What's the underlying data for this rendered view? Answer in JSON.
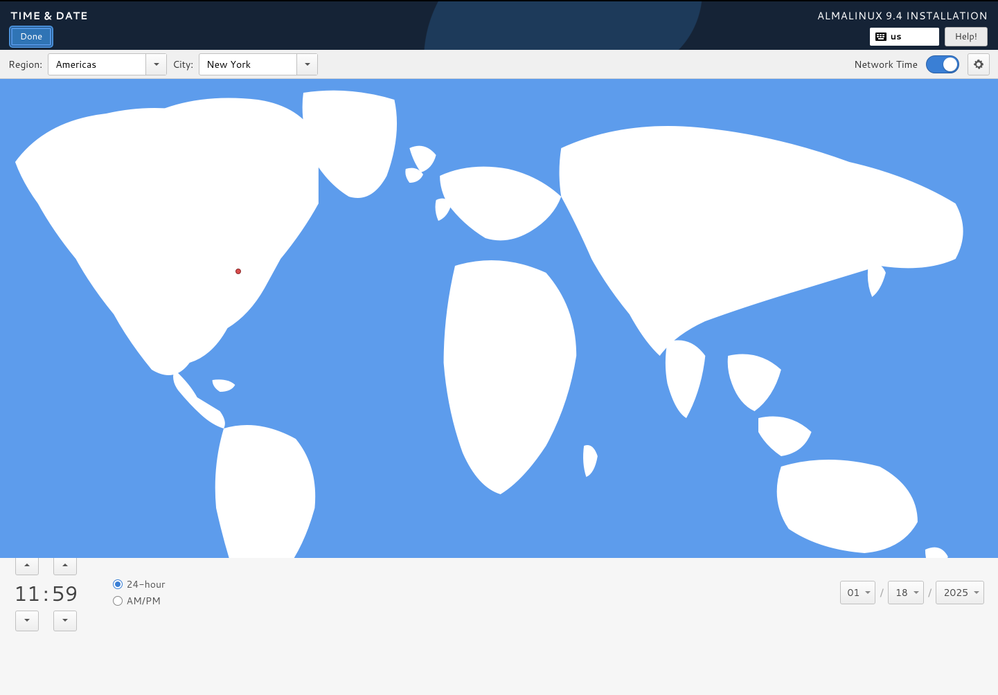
{
  "header": {
    "title": "TIME & DATE",
    "done_label": "Done",
    "install_title": "ALMALINUX 9.4 INSTALLATION",
    "keyboard_layout": "us",
    "help_label": "Help!"
  },
  "toolbar": {
    "region_label": "Region:",
    "region_value": "Americas",
    "city_label": "City:",
    "city_value": "New York",
    "network_time_label": "Network Time",
    "network_time_on": true
  },
  "map": {
    "marker_city": "New York"
  },
  "time": {
    "hours": "11",
    "minutes": "59"
  },
  "format": {
    "opt_24": "24-hour",
    "opt_ampm": "AM/PM",
    "selected": "24-hour"
  },
  "date": {
    "month": "01",
    "day": "18",
    "year": "2025"
  }
}
